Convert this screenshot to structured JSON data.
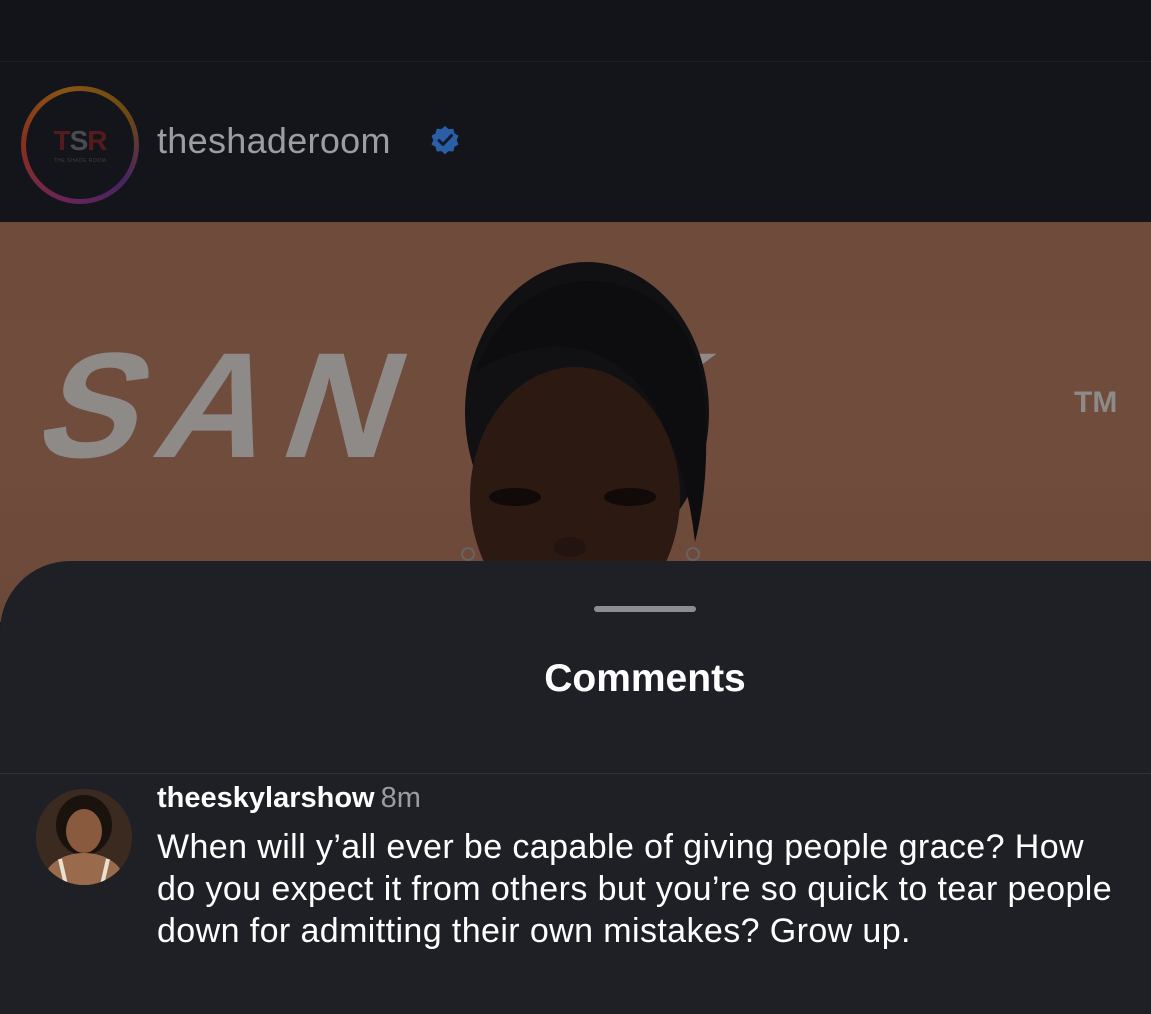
{
  "post": {
    "username": "theshaderoom",
    "verified": true,
    "avatar_logo": "TSR",
    "avatar_logo_sub": "THE SHADE ROOM"
  },
  "photo": {
    "backdrop_text": "SAN  SK",
    "trademark": "TM"
  },
  "comments_sheet": {
    "title": "Comments",
    "items": [
      {
        "username": "theeskylarshow",
        "time": "8m",
        "text": "When will y’all ever be capable of giving people grace? How do you expect it from others but you’re so quick to tear people down for admitting their own mistakes? Grow up."
      }
    ]
  },
  "colors": {
    "background": "#111318",
    "sheet": "#1f2026",
    "verified_badge": "#2a5fa8",
    "text_primary": "#ffffff",
    "text_secondary": "#9b9ca2"
  },
  "icons": [
    "verified-badge-icon"
  ]
}
